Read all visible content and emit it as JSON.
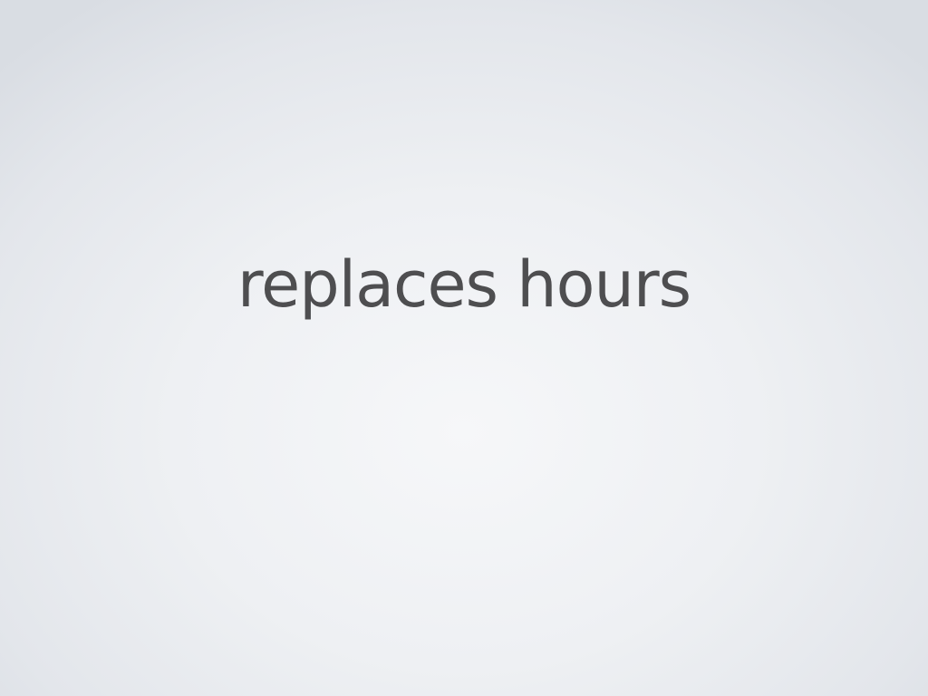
{
  "slide": {
    "title": "replaces hours"
  },
  "colors": {
    "text": "#4e4e50",
    "background_center": "#f6f7f9",
    "background_edge": "#d9dde3"
  }
}
